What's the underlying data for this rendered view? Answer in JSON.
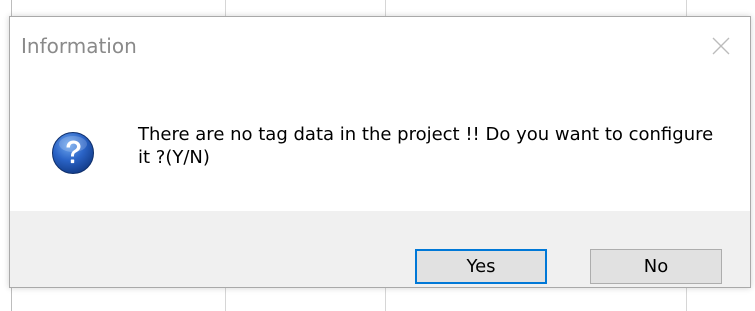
{
  "dialog": {
    "title": "Information",
    "message": "There are no tag data in the project !! Do you want to configure it ?(Y/N)",
    "icon": "question-icon",
    "buttons": {
      "yes_label": "Yes",
      "no_label": "No"
    }
  },
  "colors": {
    "accent": "#0078d7",
    "footer_bg": "#f0f0f0",
    "button_bg": "#e1e1e1",
    "title_text": "#8a8a8a"
  }
}
